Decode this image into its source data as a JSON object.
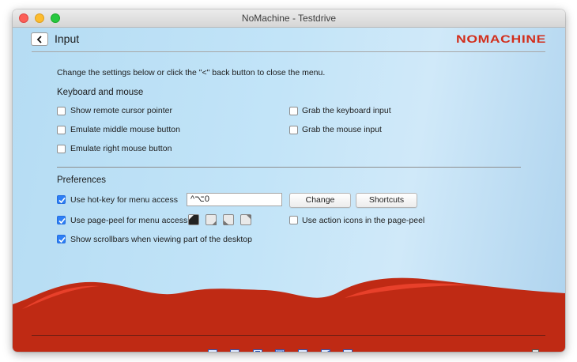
{
  "window": {
    "title": "NoMachine - Testdrive"
  },
  "header": {
    "back_label": "<",
    "title": "Input",
    "brand": "NOMACHINE"
  },
  "instructions": "Change the settings below or click the \"<\" back button to close the menu.",
  "keyboard_mouse": {
    "heading": "Keyboard and mouse",
    "options": [
      {
        "label": "Show remote cursor pointer",
        "checked": false
      },
      {
        "label": "Emulate middle mouse button",
        "checked": false
      },
      {
        "label": "Emulate right mouse button",
        "checked": false
      },
      {
        "label": "Grab the keyboard input",
        "checked": false
      },
      {
        "label": "Grab the mouse input",
        "checked": false
      }
    ]
  },
  "preferences": {
    "heading": "Preferences",
    "hotkey_label": "Use hot-key for menu access",
    "hotkey_value": "^⌥0",
    "change_label": "Change",
    "shortcuts_label": "Shortcuts",
    "pagepeel_label": "Use page-peel for menu access",
    "pagepeel_corners": [
      "top-left",
      "bottom-right",
      "bottom-left",
      "top-right"
    ],
    "action_icons_label": "Use action icons in the page-peel",
    "scrollbars_label": "Show scrollbars when viewing part of the desktop",
    "checked": {
      "hotkey": true,
      "pagepeel": true,
      "action_icons": false,
      "scrollbars": true
    }
  },
  "colors": {
    "accent": "#2d7ff5",
    "brand": "#d22e1c",
    "wave": "#bf2a14"
  },
  "toolbar_icons": [
    "display-all-icon",
    "fit-window-icon",
    "scale-icon",
    "resize-icon",
    "fullscreen-icon",
    "viewport-icon",
    "settings-display-icon",
    "display-toggle-icon"
  ]
}
